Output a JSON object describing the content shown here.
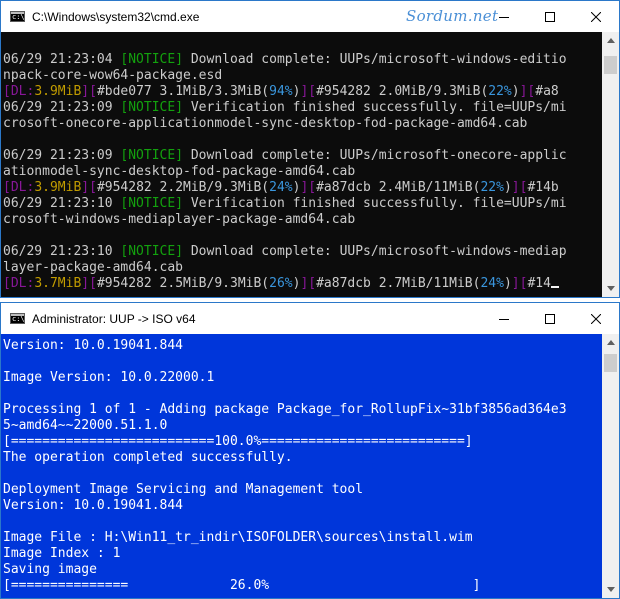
{
  "watermark": "Sordum.net",
  "cmd_window": {
    "title": "C:\\Windows\\system32\\cmd.exe",
    "lines": [
      [],
      [
        {
          "t": "06/29 21:23:04 "
        },
        {
          "t": "[",
          "c": "g"
        },
        {
          "t": "NOTICE",
          "c": "g"
        },
        {
          "t": "]",
          "c": "g"
        },
        {
          "t": " Download complete: UUPs/microsoft-windows-editio"
        }
      ],
      [
        {
          "t": "npack-core-wow64-package.esd"
        }
      ],
      [
        {
          "t": "[DL:",
          "c": "p"
        },
        {
          "t": "3.9MiB",
          "c": "y"
        },
        {
          "t": "][",
          "c": "p"
        },
        {
          "t": "#bde077 3.1MiB/3.3MiB("
        },
        {
          "t": "94%",
          "c": "c"
        },
        {
          "t": ")"
        },
        {
          "t": "][",
          "c": "p"
        },
        {
          "t": "#954282 2.0MiB/9.3MiB("
        },
        {
          "t": "22%",
          "c": "c"
        },
        {
          "t": ")"
        },
        {
          "t": "][",
          "c": "p"
        },
        {
          "t": "#a8"
        }
      ],
      [
        {
          "t": "06/29 21:23:09 "
        },
        {
          "t": "[",
          "c": "g"
        },
        {
          "t": "NOTICE",
          "c": "g"
        },
        {
          "t": "]",
          "c": "g"
        },
        {
          "t": " Verification finished successfully. file=UUPs/mi"
        }
      ],
      [
        {
          "t": "crosoft-onecore-applicationmodel-sync-desktop-fod-package-amd64.cab"
        }
      ],
      [],
      [
        {
          "t": "06/29 21:23:09 "
        },
        {
          "t": "[",
          "c": "g"
        },
        {
          "t": "NOTICE",
          "c": "g"
        },
        {
          "t": "]",
          "c": "g"
        },
        {
          "t": " Download complete: UUPs/microsoft-onecore-applic"
        }
      ],
      [
        {
          "t": "ationmodel-sync-desktop-fod-package-amd64.cab"
        }
      ],
      [
        {
          "t": "[DL:",
          "c": "p"
        },
        {
          "t": "3.9MiB",
          "c": "y"
        },
        {
          "t": "][",
          "c": "p"
        },
        {
          "t": "#954282 2.2MiB/9.3MiB("
        },
        {
          "t": "24%",
          "c": "c"
        },
        {
          "t": ")"
        },
        {
          "t": "][",
          "c": "p"
        },
        {
          "t": "#a87dcb 2.4MiB/11MiB("
        },
        {
          "t": "22%",
          "c": "c"
        },
        {
          "t": ")"
        },
        {
          "t": "][",
          "c": "p"
        },
        {
          "t": "#14b"
        }
      ],
      [
        {
          "t": "06/29 21:23:10 "
        },
        {
          "t": "[",
          "c": "g"
        },
        {
          "t": "NOTICE",
          "c": "g"
        },
        {
          "t": "]",
          "c": "g"
        },
        {
          "t": " Verification finished successfully. file=UUPs/mi"
        }
      ],
      [
        {
          "t": "crosoft-windows-mediaplayer-package-amd64.cab"
        }
      ],
      [],
      [
        {
          "t": "06/29 21:23:10 "
        },
        {
          "t": "[",
          "c": "g"
        },
        {
          "t": "NOTICE",
          "c": "g"
        },
        {
          "t": "]",
          "c": "g"
        },
        {
          "t": " Download complete: UUPs/microsoft-windows-mediap"
        }
      ],
      [
        {
          "t": "layer-package-amd64.cab"
        }
      ],
      [
        {
          "t": "[DL:",
          "c": "p"
        },
        {
          "t": "3.7MiB",
          "c": "y"
        },
        {
          "t": "][",
          "c": "p"
        },
        {
          "t": "#954282 2.5MiB/9.3MiB("
        },
        {
          "t": "26%",
          "c": "c"
        },
        {
          "t": ")"
        },
        {
          "t": "][",
          "c": "p"
        },
        {
          "t": "#a87dcb 2.7MiB/11MiB("
        },
        {
          "t": "24%",
          "c": "c"
        },
        {
          "t": ")"
        },
        {
          "t": "][",
          "c": "p"
        },
        {
          "t": "#14"
        }
      ]
    ]
  },
  "admin_window": {
    "title": "Administrator:  UUP -> ISO v64",
    "lines": [
      "Version: 10.0.19041.844",
      "",
      "Image Version: 10.0.22000.1",
      "",
      "Processing 1 of 1 - Adding package Package_for_RollupFix~31bf3856ad364e3",
      "5~amd64~~22000.51.1.0",
      "[==========================100.0%==========================]",
      "The operation completed successfully.",
      "",
      "Deployment Image Servicing and Management tool",
      "Version: 10.0.19041.844",
      "",
      "Image File : H:\\Win11_tr_indir\\ISOFOLDER\\sources\\install.wim",
      "Image Index : 1",
      "Saving image",
      "[===============             26.0%                          ]"
    ]
  },
  "icons": [
    "console-app-icon",
    "minimize-icon",
    "maximize-icon",
    "close-icon",
    "scroll-up-arrow-icon",
    "scroll-down-arrow-icon"
  ]
}
